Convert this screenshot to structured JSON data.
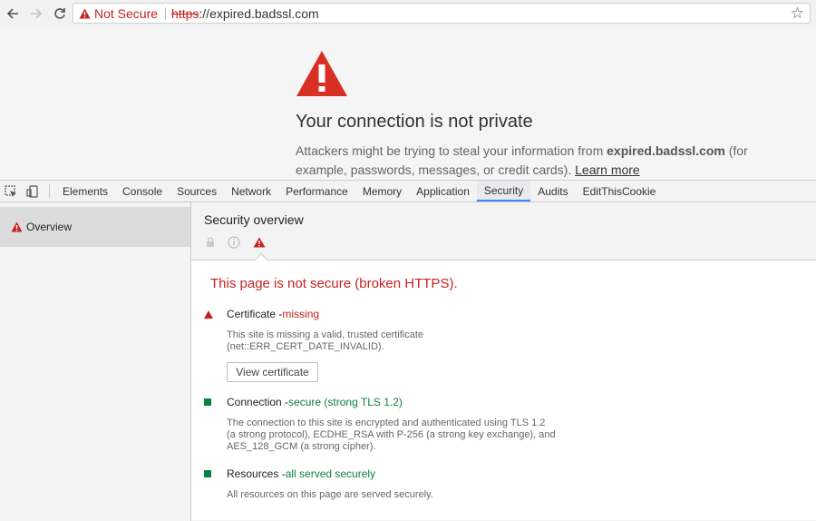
{
  "browser": {
    "security_label": "Not Secure",
    "url_scheme": "https",
    "url_rest": "://expired.badssl.com",
    "icons": {
      "back": "back-arrow-icon",
      "forward": "forward-arrow-icon",
      "reload": "reload-icon",
      "bookmark": "star-icon"
    }
  },
  "interstitial": {
    "heading": "Your connection is not private",
    "desc_prefix": "Attackers might be trying to steal your information from ",
    "desc_host": "expired.badssl.com",
    "desc_suffix": " (for example, passwords, messages, or credit cards). ",
    "learn_more": "Learn more"
  },
  "devtools": {
    "tabs": [
      "Elements",
      "Console",
      "Sources",
      "Network",
      "Performance",
      "Memory",
      "Application",
      "Security",
      "Audits",
      "EditThisCookie"
    ],
    "active_tab": "Security",
    "sidebar": {
      "overview_label": "Overview"
    },
    "security": {
      "title": "Security overview",
      "summary": "This page is not secure (broken HTTPS).",
      "certificate": {
        "label": "Certificate - ",
        "status": "missing",
        "desc_line1": "This site is missing a valid, trusted certificate",
        "desc_line2": "(net::ERR_CERT_DATE_INVALID).",
        "button": "View certificate"
      },
      "connection": {
        "label": "Connection - ",
        "status": "secure (strong TLS 1.2)",
        "desc_line1": "The connection to this site is encrypted and authenticated using TLS 1.2",
        "desc_line2": "(a strong protocol), ECDHE_RSA with P-256 (a strong key exchange), and",
        "desc_line3": "AES_128_GCM (a strong cipher)."
      },
      "resources": {
        "label": "Resources - ",
        "status": "all served securely",
        "desc": "All resources on this page are served securely."
      }
    }
  },
  "colors": {
    "danger": "#c5221f",
    "secure": "#0b8043",
    "accent": "#3e82f7"
  }
}
